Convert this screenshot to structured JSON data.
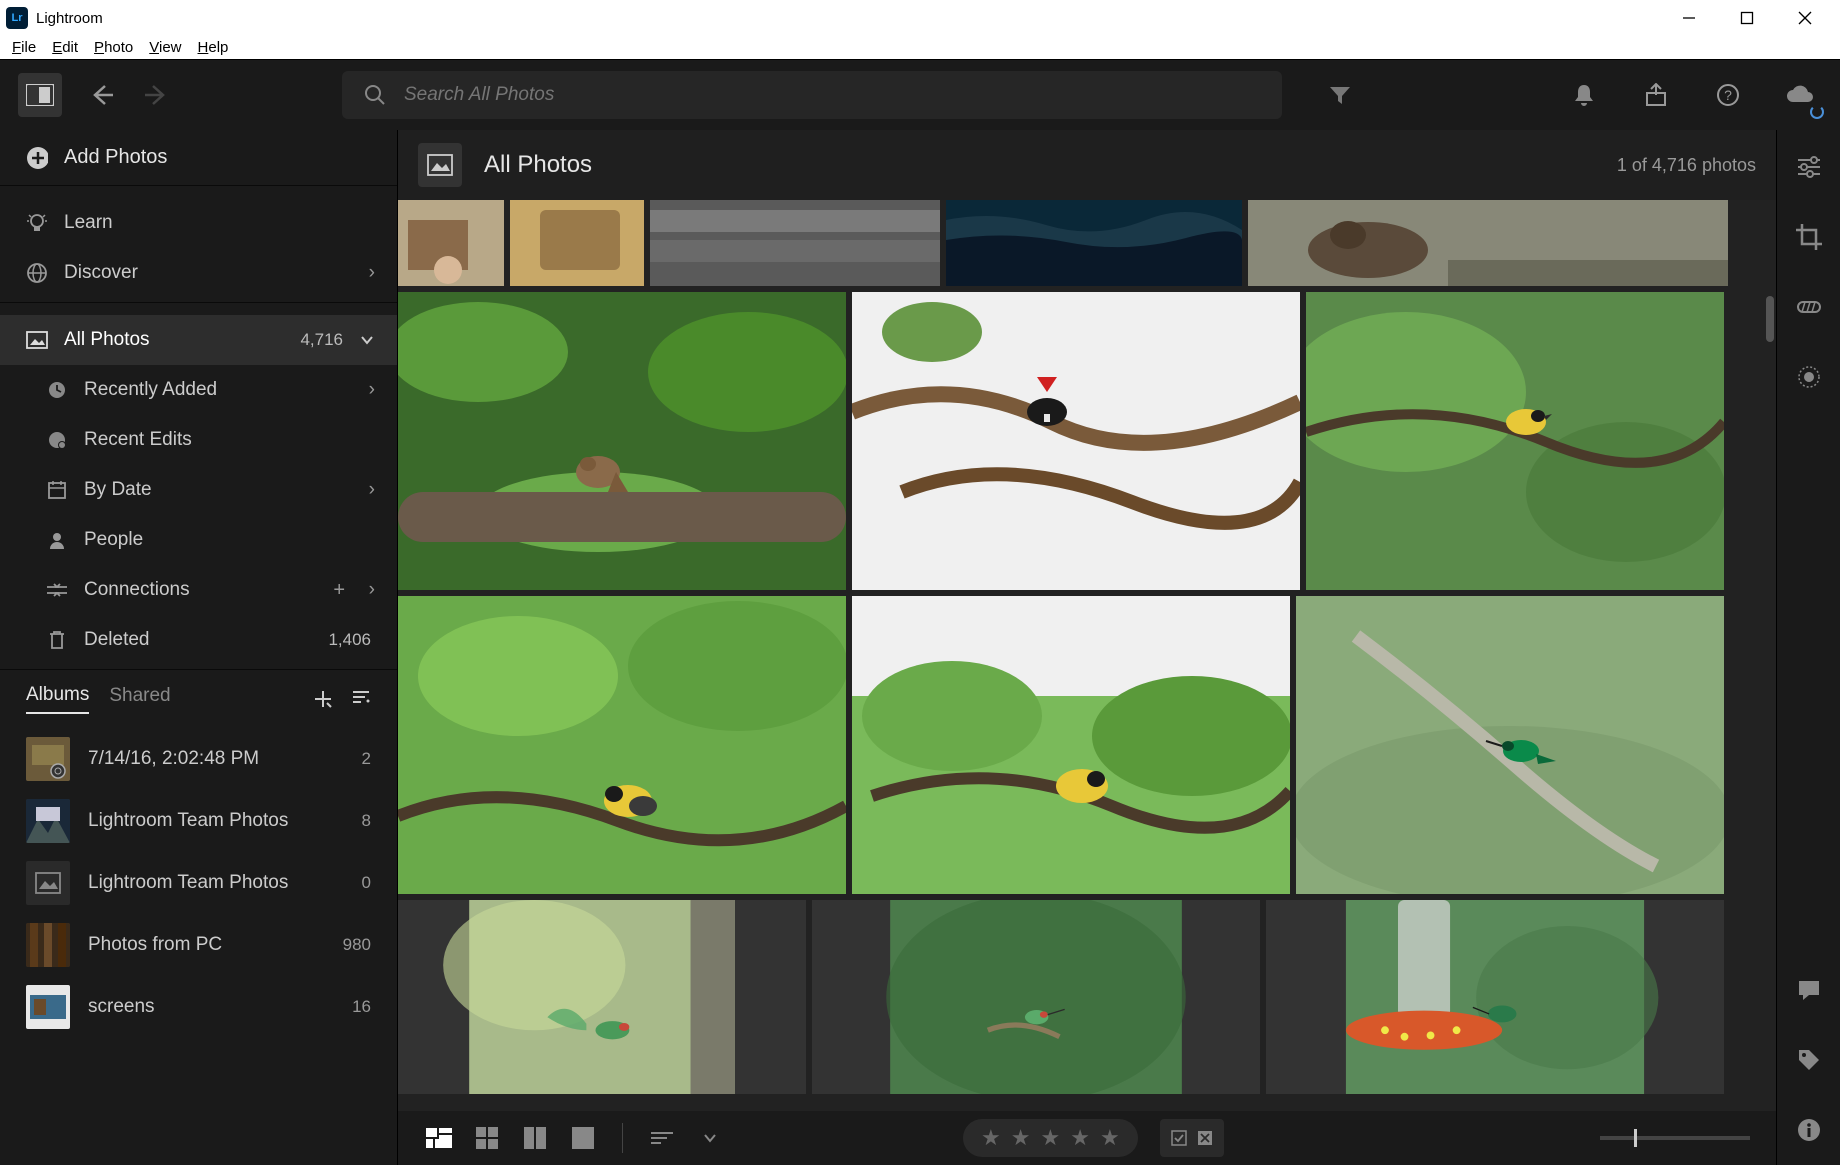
{
  "titlebar": {
    "app_name": "Lightroom"
  },
  "menubar": {
    "items": [
      "File",
      "Edit",
      "Photo",
      "View",
      "Help"
    ]
  },
  "toolbar": {
    "search_placeholder": "Search All Photos"
  },
  "sidebar": {
    "add_photos": "Add Photos",
    "learn": "Learn",
    "discover": "Discover",
    "library": {
      "all_photos": {
        "label": "All Photos",
        "count": "4,716"
      },
      "recently_added": "Recently Added",
      "recent_edits": "Recent Edits",
      "by_date": "By Date",
      "people": "People",
      "connections": "Connections",
      "deleted": {
        "label": "Deleted",
        "count": "1,406"
      }
    },
    "albums_tabs": {
      "albums": "Albums",
      "shared": "Shared"
    },
    "albums": [
      {
        "name": "7/14/16, 2:02:48 PM",
        "count": "2"
      },
      {
        "name": "Lightroom Team Photos",
        "count": "8"
      },
      {
        "name": "Lightroom Team Photos",
        "count": "0"
      },
      {
        "name": "Photos from PC",
        "count": "980"
      },
      {
        "name": "screens",
        "count": "16"
      }
    ]
  },
  "content": {
    "title": "All Photos",
    "status": "1 of 4,716 photos"
  }
}
